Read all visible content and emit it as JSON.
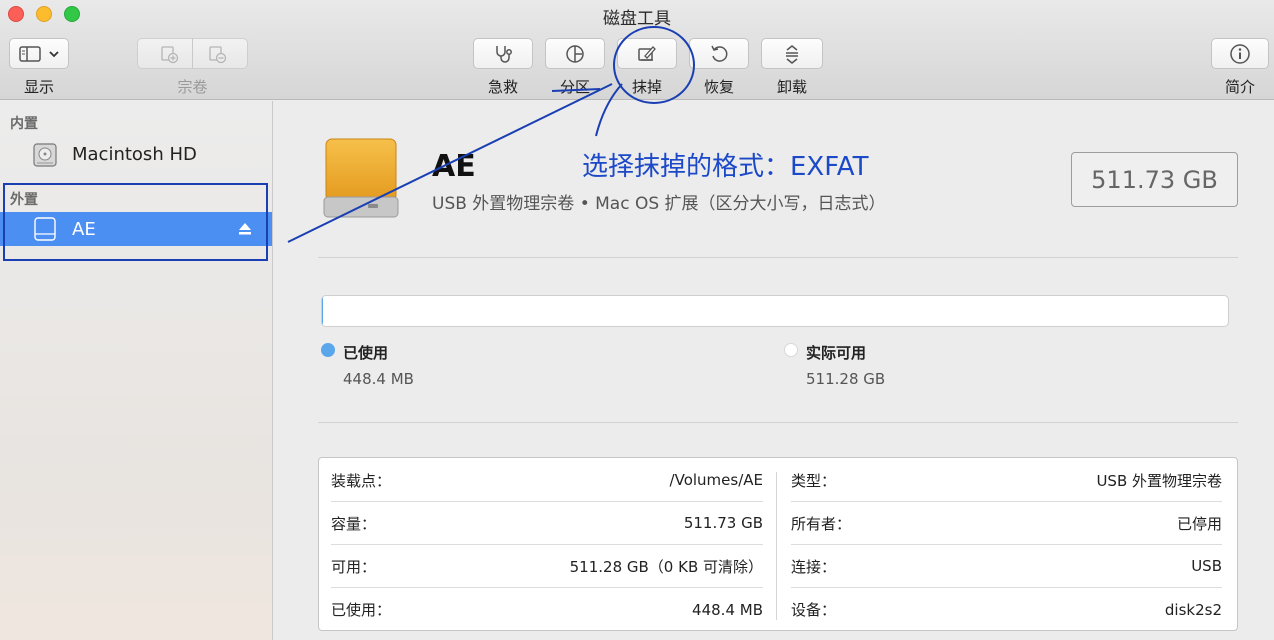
{
  "window": {
    "title": "磁盘工具"
  },
  "toolbar": {
    "view_label": "显示",
    "volume_label": "宗卷",
    "first_aid_label": "急救",
    "partition_label": "分区",
    "erase_label": "抹掉",
    "restore_label": "恢复",
    "unmount_label": "卸载",
    "info_label": "简介"
  },
  "sidebar": {
    "internal_header": "内置",
    "internal_items": [
      {
        "label": "Macintosh HD",
        "icon": "hard-drive-icon"
      }
    ],
    "external_header": "外置",
    "external_items": [
      {
        "label": "AE",
        "icon": "external-drive-icon",
        "selected": true
      }
    ]
  },
  "disk": {
    "name": "AE",
    "description": "USB 外置物理宗卷 • Mac OS 扩展（区分大小写，日志式）",
    "capacity": "511.73 GB",
    "used_fraction": 0.0009
  },
  "usage": {
    "used_title": "已使用",
    "used_value": "448.4 MB",
    "used_color": "#5aa6ea",
    "free_title": "实际可用",
    "free_value": "511.28 GB",
    "free_color": "#ffffff"
  },
  "info": {
    "left": [
      {
        "key": "装载点：",
        "value": "/Volumes/AE"
      },
      {
        "key": "容量：",
        "value": "511.73 GB"
      },
      {
        "key": "可用：",
        "value": "511.28 GB（0 KB 可清除）"
      },
      {
        "key": "已使用：",
        "value": "448.4 MB"
      }
    ],
    "right": [
      {
        "key": "类型：",
        "value": "USB 外置物理宗卷"
      },
      {
        "key": "所有者：",
        "value": "已停用"
      },
      {
        "key": "连接：",
        "value": "USB"
      },
      {
        "key": "设备：",
        "value": "disk2s2"
      }
    ]
  },
  "annotation": {
    "text": "选择抹掉的格式：EXFAT",
    "color": "#1c49c8"
  }
}
